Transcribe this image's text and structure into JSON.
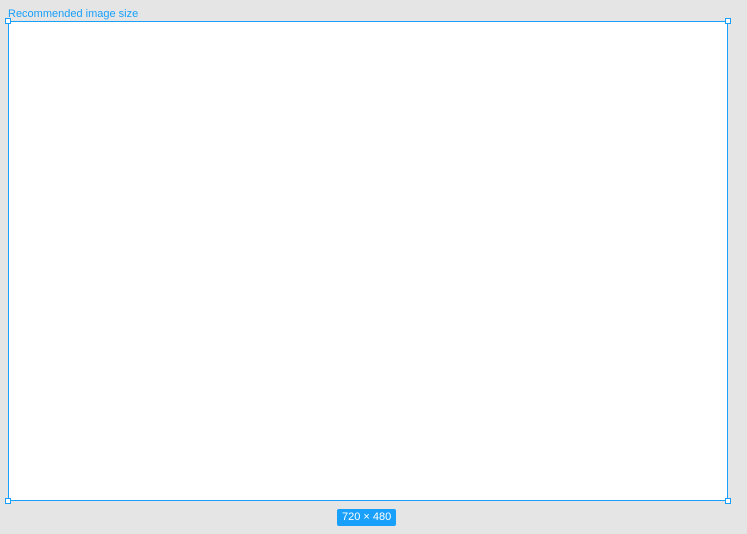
{
  "frame": {
    "label": "Recommended image size",
    "size_badge": "720 × 480"
  },
  "colors": {
    "selection_accent": "#18a0fb",
    "canvas_background": "#e5e5e5",
    "frame_fill": "#ffffff"
  }
}
